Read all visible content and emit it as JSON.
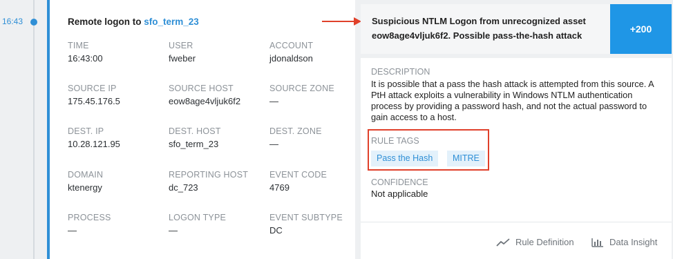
{
  "timeline": {
    "time": "16:43"
  },
  "event": {
    "title_prefix": "Remote logon to",
    "title_link": "sfo_term_23",
    "fields": [
      {
        "label": "TIME",
        "value": "16:43:00"
      },
      {
        "label": "USER",
        "value": "fweber"
      },
      {
        "label": "ACCOUNT",
        "value": "jdonaldson"
      },
      {
        "label": "SOURCE IP",
        "value": "175.45.176.5"
      },
      {
        "label": "SOURCE HOST",
        "value": "eow8age4vljuk6f2"
      },
      {
        "label": "SOURCE ZONE",
        "value": "—"
      },
      {
        "label": "DEST. IP",
        "value": "10.28.121.95"
      },
      {
        "label": "DEST. HOST",
        "value": "sfo_term_23"
      },
      {
        "label": "DEST. ZONE",
        "value": "—"
      },
      {
        "label": "DOMAIN",
        "value": "ktenergy"
      },
      {
        "label": "REPORTING HOST",
        "value": "dc_723"
      },
      {
        "label": "EVENT CODE",
        "value": "4769"
      },
      {
        "label": "PROCESS",
        "value": "—"
      },
      {
        "label": "LOGON TYPE",
        "value": "—"
      },
      {
        "label": "EVENT SUBTYPE",
        "value": "DC"
      }
    ]
  },
  "alert": {
    "title": "Suspicious NTLM Logon from unrecognized asset eow8age4vljuk6f2. Possible pass-the-hash attack",
    "score": "+200",
    "description_label": "DESCRIPTION",
    "description": "It is possible that a pass the hash attack is attempted from this source. A PtH attack exploits a vulnerability in Windows NTLM authentication process by providing a password hash, and not the actual password to gain access to a host.",
    "rule_tags_label": "RULE TAGS",
    "tags": [
      "Pass the Hash",
      "MITRE"
    ],
    "confidence_label": "CONFIDENCE",
    "confidence": "Not applicable",
    "footer": {
      "rule_definition": "Rule Definition",
      "data_insight": "Data Insight"
    }
  },
  "colors": {
    "accent": "#2f8fd6",
    "score_bg": "#1f96e6",
    "annotation_red": "#e0402a",
    "tag_bg": "#e3f1fb"
  }
}
